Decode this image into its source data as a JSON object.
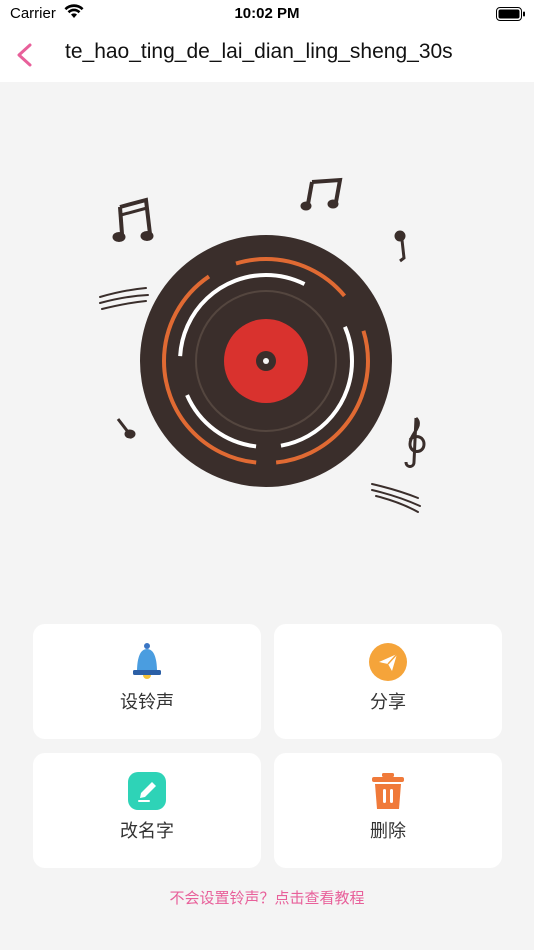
{
  "status_bar": {
    "carrier": "Carrier",
    "time": "10:02 PM"
  },
  "nav": {
    "title": "te_hao_ting_de_lai_dian_ling_sheng_30s",
    "accent_color": "#e8609a"
  },
  "record": {
    "disc_color": "#3a2e2b",
    "label_color": "#d9322e",
    "ring_color": "#e06a33"
  },
  "actions": [
    {
      "label": "设铃声",
      "icon": "bell-icon",
      "color": "#4a9de0"
    },
    {
      "label": "分享",
      "icon": "send-icon",
      "color": "#f5a43a"
    },
    {
      "label": "改名字",
      "icon": "edit-icon",
      "color": "#2ed3b7"
    },
    {
      "label": "删除",
      "icon": "trash-icon",
      "color": "#f07a3a"
    }
  ],
  "tutorial_link": "不会设置铃声？点击查看教程"
}
